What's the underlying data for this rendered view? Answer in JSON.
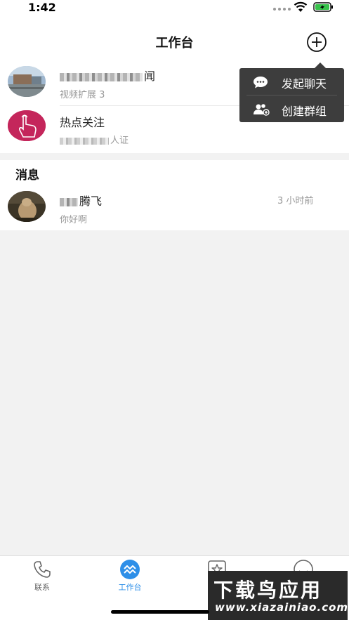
{
  "status_bar": {
    "time": "1:42"
  },
  "header": {
    "title": "工作台"
  },
  "rows": [
    {
      "title_tail": "闻",
      "subtitle": "视频扩展 3"
    },
    {
      "title": "热点关注",
      "subtitle_tail": "人证"
    }
  ],
  "messages": {
    "section_label": "消息",
    "items": [
      {
        "name_tail": "腾飞",
        "preview": "你好啊",
        "time": "3 小时前"
      }
    ]
  },
  "popup": {
    "items": [
      {
        "label": "发起聊天",
        "icon": "chat-bubble-icon"
      },
      {
        "label": "创建群组",
        "icon": "group-add-icon"
      }
    ]
  },
  "tab_bar": {
    "active_color": "#2e8fe8",
    "tabs": [
      {
        "label": "联系",
        "icon": "phone-icon"
      },
      {
        "label": "工作台",
        "icon": "workbench-icon",
        "active": true
      },
      {
        "label": "",
        "icon": "star-icon"
      },
      {
        "label": "",
        "icon": "smile-icon"
      }
    ]
  },
  "watermark": {
    "main": "下载鸟应用",
    "url": "www.xiazainiao.com"
  }
}
